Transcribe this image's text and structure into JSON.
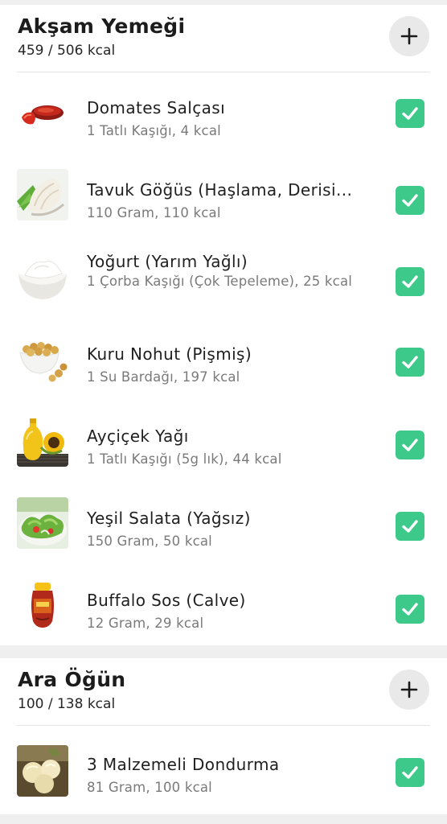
{
  "colors": {
    "check_green": "#3cc98a",
    "add_button_bg": "#e9e9e9",
    "title_text": "#1c1c1c",
    "secondary_text": "#7a7a7a"
  },
  "meals": [
    {
      "title": "Akşam Yemeği",
      "kcal": "459 / 506 kcal",
      "add_icon": "plus-icon",
      "items": [
        {
          "name": "Domates Salçası",
          "detail": "1 Tatlı Kaşığı, 4 kcal",
          "checked": true,
          "thumb": "tomato-paste"
        },
        {
          "name": "Tavuk Göğüs (Haşlama, Derisi...",
          "detail": "110 Gram, 110 kcal",
          "checked": true,
          "thumb": "chicken-breast"
        },
        {
          "name": "Yoğurt (Yarım Yağlı)",
          "detail": "1 Çorba Kaşığı (Çok Tepeleme), 25 kcal",
          "checked": true,
          "thumb": "yogurt"
        },
        {
          "name": "Kuru Nohut (Pişmiş)",
          "detail": "1 Su Bardağı, 197 kcal",
          "checked": true,
          "thumb": "chickpeas"
        },
        {
          "name": "Ayçiçek Yağı",
          "detail": "1 Tatlı Kaşığı (5g lık), 44 kcal",
          "checked": true,
          "thumb": "sunflower-oil"
        },
        {
          "name": "Yeşil Salata (Yağsız)",
          "detail": "150 Gram, 50 kcal",
          "checked": true,
          "thumb": "green-salad"
        },
        {
          "name": "Buffalo Sos (Calve)",
          "detail": "12 Gram, 29 kcal",
          "checked": true,
          "thumb": "buffalo-sauce"
        }
      ]
    },
    {
      "title": "Ara Öğün",
      "kcal": "100 / 138 kcal",
      "add_icon": "plus-icon",
      "items": [
        {
          "name": "3 Malzemeli Dondurma",
          "detail": "81 Gram, 100 kcal",
          "checked": true,
          "thumb": "ice-cream"
        }
      ]
    }
  ]
}
